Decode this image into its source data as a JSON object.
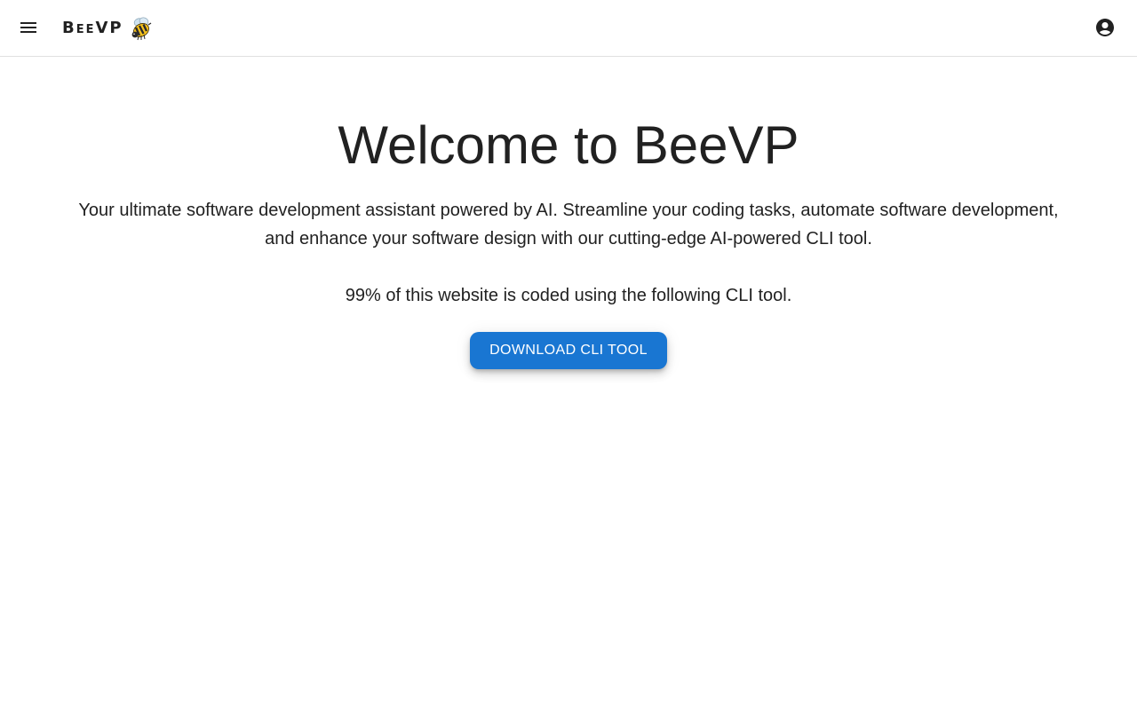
{
  "header": {
    "brand_name": "BeeVP",
    "brand_emoji_icon": "bee-icon",
    "menu_icon": "menu-icon",
    "account_icon": "account-circle-icon"
  },
  "hero": {
    "title": "Welcome to BeeVP",
    "description": "Your ultimate software development assistant powered by AI. Streamline your coding tasks, automate software development, and enhance your software design with our cutting-edge AI-powered CLI tool.",
    "note": "99% of this website is coded using the following CLI tool.",
    "download_label": "Download CLI Tool"
  },
  "colors": {
    "primary": "#1976d2",
    "text": "#212121",
    "divider": "#e0e0e0",
    "background": "#ffffff"
  }
}
